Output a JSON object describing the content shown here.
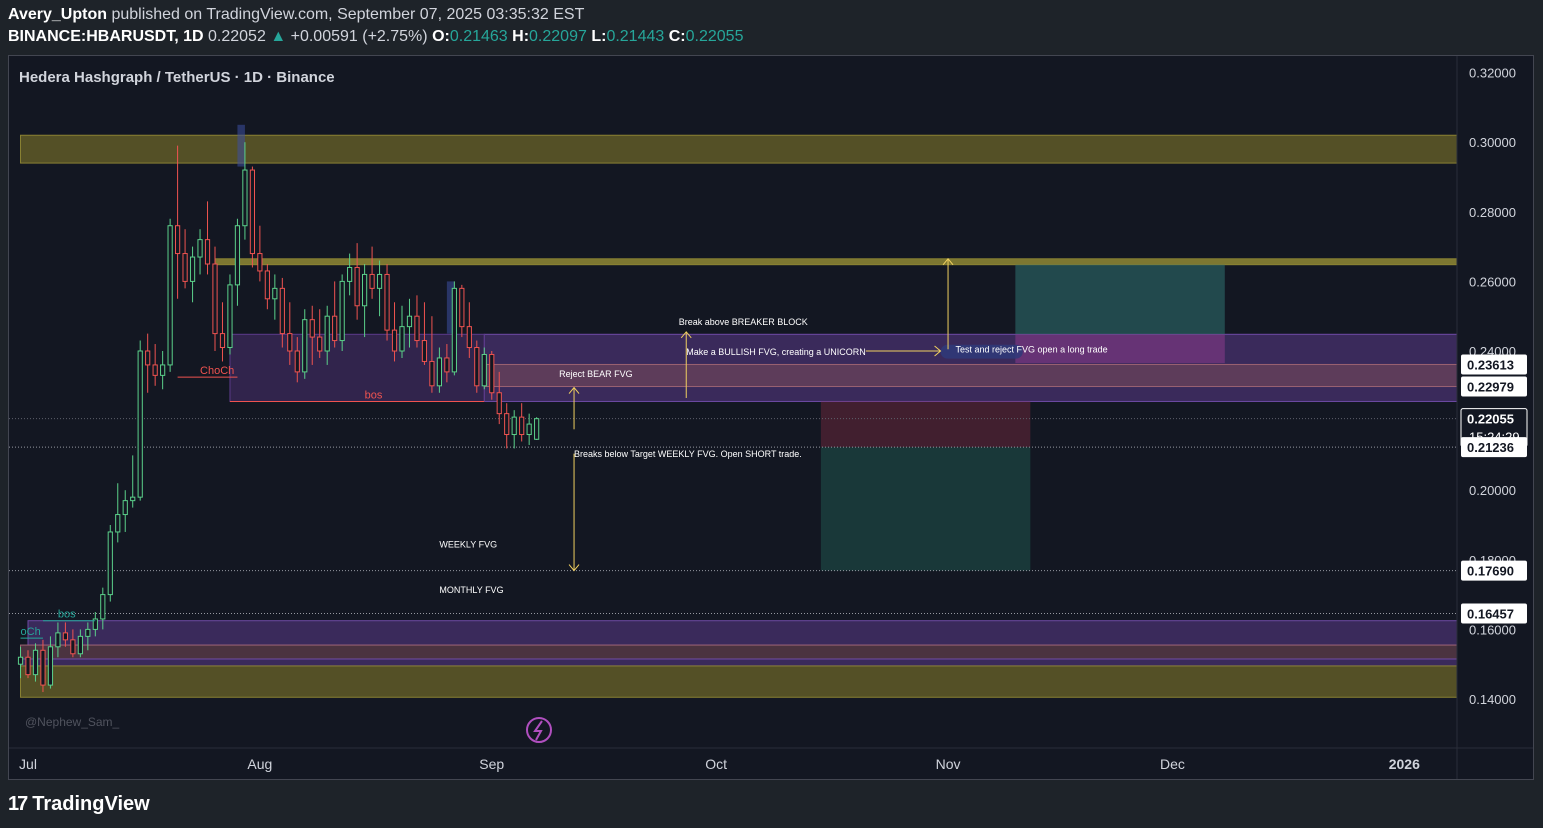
{
  "header": {
    "author": "Avery_Upton",
    "published_text": "published on TradingView.com, September 07, 2025 03:35:32 EST",
    "symbol": "BINANCE:HBARUSDT, 1D",
    "last_price": "0.22052",
    "change": "+0.00591 (+2.75%)",
    "o_label": "O:",
    "o_value": "0.21463",
    "h_label": "H:",
    "h_value": "0.22097",
    "l_label": "L:",
    "l_value": "0.21443",
    "c_label": "C:",
    "c_value": "0.22055",
    "up_arrow": "▲"
  },
  "chart_title": "Hedera Hashgraph / TetherUS · 1D · Binance",
  "watermark": "@Nephew_Sam_",
  "footer": {
    "brand": "TradingView",
    "logo": "17"
  },
  "colors": {
    "background": "#131722",
    "up": "#26a69a",
    "up_body": "#5bd08a",
    "down": "#ef5350",
    "yellow_zone": "#6b6428",
    "purple_zone": "#5b3a8a",
    "text": "#d1d4dc"
  },
  "chart_data": {
    "type": "candlestick",
    "symbol": "HBARUSDT",
    "interval": "1D",
    "ylim": [
      0.135,
      0.325
    ],
    "y_ticks": [
      "0.32000",
      "0.30000",
      "0.28000",
      "0.26000",
      "0.24000",
      "0.22000",
      "0.20000",
      "0.18000",
      "0.16000",
      "0.14000"
    ],
    "x_ticks": [
      {
        "label": "Jul",
        "date": "2025-07-01"
      },
      {
        "label": "Aug",
        "date": "2025-08-01"
      },
      {
        "label": "Sep",
        "date": "2025-09-01"
      },
      {
        "label": "Oct",
        "date": "2025-10-01"
      },
      {
        "label": "Nov",
        "date": "2025-11-01"
      },
      {
        "label": "Dec",
        "date": "2025-12-01"
      },
      {
        "label": "2026",
        "date": "2026-01-01"
      }
    ],
    "price_labels": [
      {
        "text": "0.23613",
        "value": 0.23613,
        "style": "plain"
      },
      {
        "text": "0.22979",
        "value": 0.22979,
        "style": "plain"
      },
      {
        "text": "0.22055",
        "value": 0.22055,
        "style": "current",
        "sub": "15:24:29"
      },
      {
        "text": "0.21236",
        "value": 0.21236,
        "style": "plain"
      },
      {
        "text": "0.17690",
        "value": 0.1769,
        "style": "plain"
      },
      {
        "text": "0.16457",
        "value": 0.16457,
        "style": "plain"
      }
    ],
    "candles": [
      {
        "date": "2025-06-30",
        "o": 0.15,
        "h": 0.155,
        "l": 0.146,
        "c": 0.152
      },
      {
        "date": "2025-07-01",
        "o": 0.152,
        "h": 0.154,
        "l": 0.146,
        "c": 0.147
      },
      {
        "date": "2025-07-02",
        "o": 0.147,
        "h": 0.156,
        "l": 0.145,
        "c": 0.154
      },
      {
        "date": "2025-07-03",
        "o": 0.154,
        "h": 0.157,
        "l": 0.142,
        "c": 0.144
      },
      {
        "date": "2025-07-04",
        "o": 0.144,
        "h": 0.158,
        "l": 0.143,
        "c": 0.155
      },
      {
        "date": "2025-07-05",
        "o": 0.155,
        "h": 0.162,
        "l": 0.152,
        "c": 0.159
      },
      {
        "date": "2025-07-06",
        "o": 0.159,
        "h": 0.162,
        "l": 0.155,
        "c": 0.157
      },
      {
        "date": "2025-07-07",
        "o": 0.157,
        "h": 0.16,
        "l": 0.152,
        "c": 0.153
      },
      {
        "date": "2025-07-08",
        "o": 0.153,
        "h": 0.16,
        "l": 0.152,
        "c": 0.158
      },
      {
        "date": "2025-07-09",
        "o": 0.158,
        "h": 0.162,
        "l": 0.154,
        "c": 0.16
      },
      {
        "date": "2025-07-10",
        "o": 0.16,
        "h": 0.165,
        "l": 0.158,
        "c": 0.163
      },
      {
        "date": "2025-07-11",
        "o": 0.163,
        "h": 0.172,
        "l": 0.16,
        "c": 0.17
      },
      {
        "date": "2025-07-12",
        "o": 0.17,
        "h": 0.19,
        "l": 0.168,
        "c": 0.188
      },
      {
        "date": "2025-07-13",
        "o": 0.188,
        "h": 0.202,
        "l": 0.185,
        "c": 0.193
      },
      {
        "date": "2025-07-14",
        "o": 0.193,
        "h": 0.2,
        "l": 0.188,
        "c": 0.197
      },
      {
        "date": "2025-07-15",
        "o": 0.197,
        "h": 0.21,
        "l": 0.195,
        "c": 0.198
      },
      {
        "date": "2025-07-16",
        "o": 0.198,
        "h": 0.243,
        "l": 0.197,
        "c": 0.24
      },
      {
        "date": "2025-07-17",
        "o": 0.24,
        "h": 0.245,
        "l": 0.228,
        "c": 0.236
      },
      {
        "date": "2025-07-18",
        "o": 0.236,
        "h": 0.242,
        "l": 0.23,
        "c": 0.233
      },
      {
        "date": "2025-07-19",
        "o": 0.233,
        "h": 0.24,
        "l": 0.229,
        "c": 0.236
      },
      {
        "date": "2025-07-20",
        "o": 0.236,
        "h": 0.278,
        "l": 0.234,
        "c": 0.276
      },
      {
        "date": "2025-07-21",
        "o": 0.276,
        "h": 0.299,
        "l": 0.255,
        "c": 0.268
      },
      {
        "date": "2025-07-22",
        "o": 0.268,
        "h": 0.275,
        "l": 0.258,
        "c": 0.26
      },
      {
        "date": "2025-07-23",
        "o": 0.26,
        "h": 0.27,
        "l": 0.254,
        "c": 0.267
      },
      {
        "date": "2025-07-24",
        "o": 0.267,
        "h": 0.275,
        "l": 0.262,
        "c": 0.272
      },
      {
        "date": "2025-07-25",
        "o": 0.272,
        "h": 0.283,
        "l": 0.262,
        "c": 0.265
      },
      {
        "date": "2025-07-26",
        "o": 0.265,
        "h": 0.27,
        "l": 0.24,
        "c": 0.245
      },
      {
        "date": "2025-07-27",
        "o": 0.245,
        "h": 0.254,
        "l": 0.237,
        "c": 0.241
      },
      {
        "date": "2025-07-28",
        "o": 0.241,
        "h": 0.262,
        "l": 0.239,
        "c": 0.259
      },
      {
        "date": "2025-07-29",
        "o": 0.259,
        "h": 0.278,
        "l": 0.253,
        "c": 0.276
      },
      {
        "date": "2025-07-30",
        "o": 0.276,
        "h": 0.3,
        "l": 0.272,
        "c": 0.292
      },
      {
        "date": "2025-07-31",
        "o": 0.292,
        "h": 0.293,
        "l": 0.264,
        "c": 0.268
      },
      {
        "date": "2025-08-01",
        "o": 0.268,
        "h": 0.276,
        "l": 0.26,
        "c": 0.263
      },
      {
        "date": "2025-08-02",
        "o": 0.263,
        "h": 0.265,
        "l": 0.252,
        "c": 0.255
      },
      {
        "date": "2025-08-03",
        "o": 0.255,
        "h": 0.262,
        "l": 0.249,
        "c": 0.258
      },
      {
        "date": "2025-08-04",
        "o": 0.258,
        "h": 0.261,
        "l": 0.241,
        "c": 0.245
      },
      {
        "date": "2025-08-05",
        "o": 0.245,
        "h": 0.254,
        "l": 0.236,
        "c": 0.24
      },
      {
        "date": "2025-08-06",
        "o": 0.24,
        "h": 0.244,
        "l": 0.231,
        "c": 0.234
      },
      {
        "date": "2025-08-07",
        "o": 0.234,
        "h": 0.252,
        "l": 0.232,
        "c": 0.249
      },
      {
        "date": "2025-08-08",
        "o": 0.249,
        "h": 0.253,
        "l": 0.236,
        "c": 0.244
      },
      {
        "date": "2025-08-09",
        "o": 0.244,
        "h": 0.252,
        "l": 0.238,
        "c": 0.24
      },
      {
        "date": "2025-08-10",
        "o": 0.24,
        "h": 0.253,
        "l": 0.236,
        "c": 0.25
      },
      {
        "date": "2025-08-11",
        "o": 0.25,
        "h": 0.26,
        "l": 0.241,
        "c": 0.243
      },
      {
        "date": "2025-08-12",
        "o": 0.243,
        "h": 0.262,
        "l": 0.24,
        "c": 0.26
      },
      {
        "date": "2025-08-13",
        "o": 0.26,
        "h": 0.268,
        "l": 0.256,
        "c": 0.264
      },
      {
        "date": "2025-08-14",
        "o": 0.264,
        "h": 0.271,
        "l": 0.249,
        "c": 0.253
      },
      {
        "date": "2025-08-15",
        "o": 0.253,
        "h": 0.265,
        "l": 0.244,
        "c": 0.262
      },
      {
        "date": "2025-08-16",
        "o": 0.262,
        "h": 0.27,
        "l": 0.255,
        "c": 0.258
      },
      {
        "date": "2025-08-17",
        "o": 0.258,
        "h": 0.266,
        "l": 0.25,
        "c": 0.262
      },
      {
        "date": "2025-08-18",
        "o": 0.262,
        "h": 0.265,
        "l": 0.243,
        "c": 0.246
      },
      {
        "date": "2025-08-19",
        "o": 0.246,
        "h": 0.254,
        "l": 0.237,
        "c": 0.24
      },
      {
        "date": "2025-08-20",
        "o": 0.24,
        "h": 0.253,
        "l": 0.238,
        "c": 0.247
      },
      {
        "date": "2025-08-21",
        "o": 0.247,
        "h": 0.255,
        "l": 0.241,
        "c": 0.25
      },
      {
        "date": "2025-08-22",
        "o": 0.25,
        "h": 0.256,
        "l": 0.241,
        "c": 0.243
      },
      {
        "date": "2025-08-23",
        "o": 0.243,
        "h": 0.254,
        "l": 0.236,
        "c": 0.237
      },
      {
        "date": "2025-08-24",
        "o": 0.237,
        "h": 0.25,
        "l": 0.228,
        "c": 0.23
      },
      {
        "date": "2025-08-25",
        "o": 0.23,
        "h": 0.241,
        "l": 0.228,
        "c": 0.238
      },
      {
        "date": "2025-08-26",
        "o": 0.238,
        "h": 0.242,
        "l": 0.231,
        "c": 0.234
      },
      {
        "date": "2025-08-27",
        "o": 0.234,
        "h": 0.26,
        "l": 0.233,
        "c": 0.258
      },
      {
        "date": "2025-08-28",
        "o": 0.258,
        "h": 0.259,
        "l": 0.244,
        "c": 0.247
      },
      {
        "date": "2025-08-29",
        "o": 0.247,
        "h": 0.254,
        "l": 0.238,
        "c": 0.241
      },
      {
        "date": "2025-08-30",
        "o": 0.241,
        "h": 0.243,
        "l": 0.228,
        "c": 0.23
      },
      {
        "date": "2025-08-31",
        "o": 0.23,
        "h": 0.241,
        "l": 0.229,
        "c": 0.239
      },
      {
        "date": "2025-09-01",
        "o": 0.239,
        "h": 0.24,
        "l": 0.226,
        "c": 0.228
      },
      {
        "date": "2025-09-02",
        "o": 0.228,
        "h": 0.234,
        "l": 0.219,
        "c": 0.222
      },
      {
        "date": "2025-09-03",
        "o": 0.222,
        "h": 0.225,
        "l": 0.212,
        "c": 0.216
      },
      {
        "date": "2025-09-04",
        "o": 0.216,
        "h": 0.223,
        "l": 0.212,
        "c": 0.221
      },
      {
        "date": "2025-09-05",
        "o": 0.221,
        "h": 0.225,
        "l": 0.214,
        "c": 0.216
      },
      {
        "date": "2025-09-06",
        "o": 0.216,
        "h": 0.222,
        "l": 0.213,
        "c": 0.219
      },
      {
        "date": "2025-09-07",
        "o": 0.21463,
        "h": 0.22097,
        "l": 0.21443,
        "c": 0.22055
      }
    ],
    "zones": [
      {
        "kind": "yellow",
        "from_date": "2025-06-30",
        "to_date": "right-edge",
        "top": 0.302,
        "bottom": 0.294
      },
      {
        "kind": "yellow-line",
        "from_date": "2025-07-26",
        "to_date": "right-edge",
        "top": 0.2665,
        "bottom": 0.2648
      },
      {
        "kind": "purple",
        "from_date": "2025-08-31",
        "to_date": "right-edge",
        "top": 0.2448,
        "bottom": 0.2255
      },
      {
        "kind": "purple-dark",
        "from_date": "2025-07-28",
        "to_date": "2025-08-31",
        "top": 0.2448,
        "bottom": 0.2255
      },
      {
        "kind": "pink",
        "from_date": "2025-08-31",
        "to_date": "right-edge",
        "top": 0.23613,
        "bottom": 0.22979
      },
      {
        "kind": "purple",
        "from_date": "2025-07-01",
        "to_date": "right-edge",
        "top": 0.1625,
        "bottom": 0.1555
      },
      {
        "kind": "pink",
        "from_date": "2025-06-30",
        "to_date": "right-edge",
        "top": 0.1555,
        "bottom": 0.1515
      },
      {
        "kind": "purple",
        "from_date": "2025-06-30",
        "to_date": "right-edge",
        "top": 0.1515,
        "bottom": 0.1495
      },
      {
        "kind": "yellow",
        "from_date": "2025-06-30",
        "to_date": "right-edge",
        "top": 0.1495,
        "bottom": 0.1405
      },
      {
        "kind": "blue-highlight",
        "from_date": "2025-07-29",
        "to_date": "2025-07-30",
        "top": 0.305,
        "bottom": 0.293
      },
      {
        "kind": "blue-highlight",
        "from_date": "2025-08-26",
        "to_date": "2025-08-27",
        "top": 0.26,
        "bottom": 0.245
      },
      {
        "kind": "short-risk",
        "from_date": "2025-10-15",
        "to_date": "2025-11-12",
        "top": 0.2255,
        "bottom": 0.21236
      },
      {
        "kind": "short-target",
        "from_date": "2025-10-15",
        "to_date": "2025-11-12",
        "top": 0.21236,
        "bottom": 0.1769
      },
      {
        "kind": "long-target",
        "from_date": "2025-11-10",
        "to_date": "2025-12-08",
        "top": 0.2648,
        "bottom": 0.2448
      },
      {
        "kind": "long-risk",
        "from_date": "2025-11-10",
        "to_date": "2025-12-08",
        "top": 0.2448,
        "bottom": 0.2365
      }
    ],
    "levels": [
      {
        "value": 0.22055,
        "style": "dotted-current"
      },
      {
        "value": 0.21236,
        "style": "dotted"
      },
      {
        "value": 0.1769,
        "style": "dotted"
      },
      {
        "value": 0.16457,
        "style": "dotted"
      }
    ],
    "structure_lines": [
      {
        "label": "ChoCh",
        "date1": "2025-07-21",
        "date2": "2025-07-29",
        "value": 0.2325,
        "color": "#ef5350",
        "label_date": "2025-07-24"
      },
      {
        "label": "bos",
        "date1": "2025-07-28",
        "date2": "2025-08-31",
        "value": 0.2255,
        "color": "#ef5350",
        "label_date": "2025-08-15"
      },
      {
        "label": "bos",
        "date1": "2025-07-03",
        "date2": "2025-07-10",
        "value": 0.1625,
        "color": "#26a69a",
        "label_date": "2025-07-05"
      },
      {
        "label": "oCh",
        "date1": "2025-06-30",
        "date2": "2025-07-03",
        "value": 0.1575,
        "color": "#26a69a",
        "label_date": "2025-06-30"
      }
    ],
    "annotations": [
      {
        "text": "Break above BREAKER BLOCK",
        "date": "2025-09-26",
        "value": 0.2475
      },
      {
        "text": "Make a BULLISH FVG, creating a UNICORN",
        "date": "2025-09-27",
        "value": 0.2388
      },
      {
        "text": "Test and reject FVG open  a long trade",
        "date": "2025-11-02",
        "value": 0.2395
      },
      {
        "text": "Reject BEAR FVG",
        "date": "2025-09-10",
        "value": 0.2325
      },
      {
        "text": "Breaks below Target WEEKLY FVG. Open SHORT trade.",
        "date": "2025-09-12",
        "value": 0.2095
      },
      {
        "text": "WEEKLY FVG",
        "date": "2025-08-25",
        "value": 0.1835
      },
      {
        "text": "MONTHLY FVG",
        "date": "2025-08-25",
        "value": 0.1705
      }
    ],
    "arrows": [
      {
        "date": "2025-09-12",
        "from": 0.2175,
        "to": 0.2295
      },
      {
        "date": "2025-09-12",
        "from": 0.2105,
        "to": 0.1769
      },
      {
        "date": "2025-09-27",
        "from": 0.2265,
        "to": 0.2455
      },
      {
        "date": "2025-11-01",
        "from": 0.2405,
        "to": 0.2665
      }
    ],
    "horizontal_arrows": [
      {
        "date1": "2025-10-21",
        "date2": "2025-10-31",
        "value": 0.24
      }
    ],
    "unicorn_zone": {
      "from_date": "2025-10-31",
      "to_date": "2025-11-11",
      "top": 0.2418,
      "bottom": 0.2378
    }
  }
}
